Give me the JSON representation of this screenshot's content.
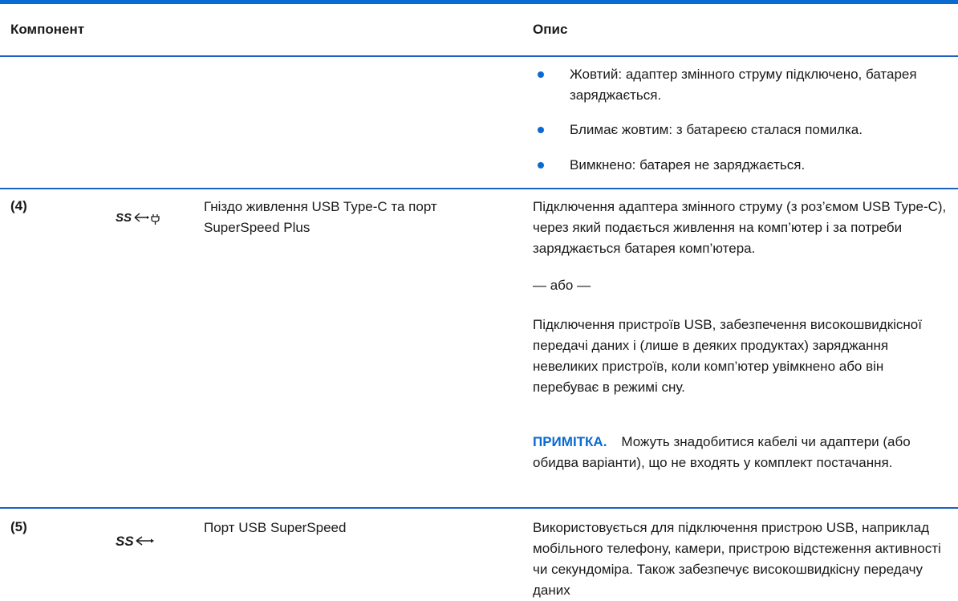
{
  "header": {
    "component": "Компонент",
    "description": "Опис"
  },
  "bullets": [
    "Жовтий: адаптер змінного струму підключено, батарея заряджається.",
    "Блимає жовтим: з батареєю сталася помилка.",
    "Вимкнено: батарея не заряджається."
  ],
  "row4": {
    "number": "(4)",
    "icon": "usb-superspeed-power-icon",
    "name": "Гніздо живлення USB Type-C та порт SuperSpeed Plus",
    "description": "Підключення адаптера змінного струму (з роз’ємом USB Type-C), через який подається живлення на комп’ютер і за потреби заряджається батарея комп’ютера.",
    "or": "— або —",
    "description2": "Підключення пристроїв USB, забезпечення високошвидкісної передачі даних і (лише в деяких продуктах) заряджання невеликих пристроїв, коли комп’ютер увімкнено або він перебуває в режимі сну.",
    "note_label": "ПРИМІТКА.",
    "note_text": "Можуть знадобитися кабелі чи адаптери (або обидва варіанти), що не входять у комплект постачання."
  },
  "row5": {
    "number": "(5)",
    "icon": "usb-superspeed-icon",
    "name": "Порт USB SuperSpeed",
    "description": "Використовується для підключення пристрою USB, наприклад мобільного телефону, камери, пристрою відстеження активності чи секундоміра. Також забезпечує високошвидкісну передачу даних"
  },
  "colors": {
    "accent": "#0a6ad2",
    "text": "#1a1a1a"
  }
}
